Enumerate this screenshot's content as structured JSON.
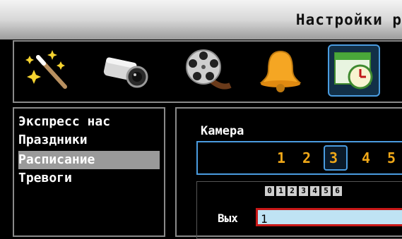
{
  "window": {
    "title": "Настройки р"
  },
  "toolbar": {
    "icons": [
      "magic-wand-icon",
      "camera-icon",
      "film-reel-icon",
      "bell-icon",
      "schedule-clock-icon"
    ],
    "selected_index": 4
  },
  "menu": {
    "items": [
      {
        "label": "Экспресс нас",
        "selected": false
      },
      {
        "label": "Праздники",
        "selected": false
      },
      {
        "label": "Расписание",
        "selected": true
      },
      {
        "label": "Тревоги",
        "selected": false
      }
    ]
  },
  "camera": {
    "label": "Камера",
    "numbers": [
      "1",
      "2",
      "3",
      "4",
      "5"
    ],
    "selected": "3"
  },
  "schedule": {
    "hours": [
      "0",
      "1",
      "2",
      "3",
      "4",
      "5",
      "6"
    ],
    "out_label": "Вых",
    "out_value": "1"
  },
  "colors": {
    "accent": "#4a9ce0",
    "highlight": "#f0a818",
    "alert_border": "#c81818"
  }
}
